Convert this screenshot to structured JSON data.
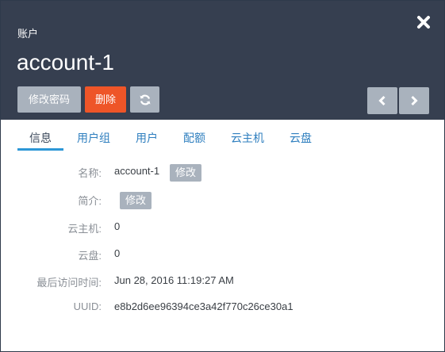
{
  "header": {
    "breadcrumb": "账户",
    "title": "account-1",
    "buttons": {
      "change_password": "修改密码",
      "delete": "删除"
    }
  },
  "tabs": [
    "信息",
    "用户组",
    "用户",
    "配额",
    "云主机",
    "云盘"
  ],
  "active_tab": 0,
  "details": {
    "name_label": "名称:",
    "name_value": "account-1",
    "name_edit": "修改",
    "desc_label": "简介:",
    "desc_edit": "修改",
    "vm_label": "云主机:",
    "vm_value": "0",
    "disk_label": "云盘:",
    "disk_value": "0",
    "last_access_label": "最后访问时间:",
    "last_access_value": "Jun 28, 2016 11:19:27 AM",
    "uuid_label": "UUID:",
    "uuid_value": "e8b2d6ee96394ce3a42f770c26ce30a1"
  },
  "icons": {
    "close": "close-icon",
    "refresh": "refresh-icon",
    "prev": "chevron-left-icon",
    "next": "chevron-right-icon"
  },
  "colors": {
    "header_bg": "#363f50",
    "danger": "#ee5528",
    "grey_button": "#a9b2bd",
    "tab_active_underline": "#2d97d6",
    "tab_link": "#2f7fbf"
  }
}
